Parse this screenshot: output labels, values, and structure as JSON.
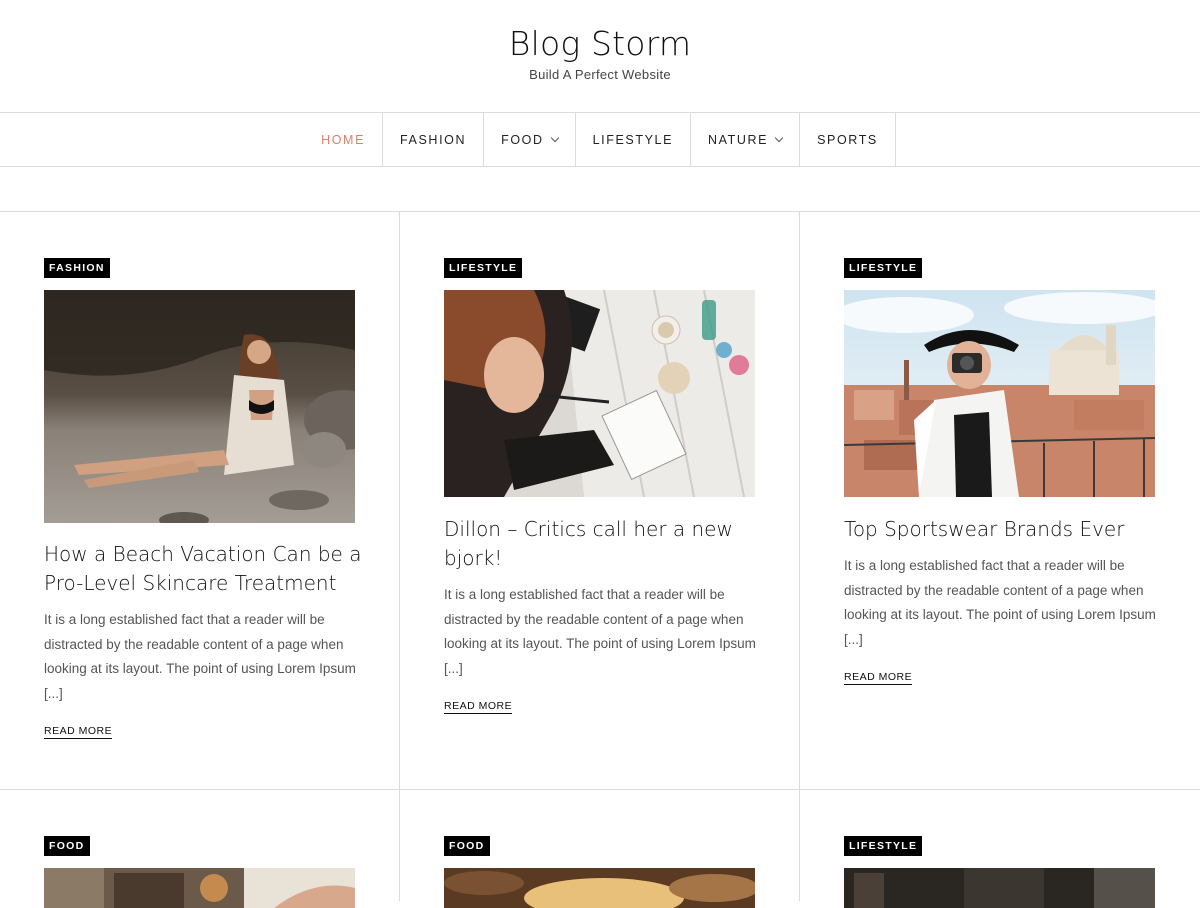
{
  "site": {
    "title": "Blog Storm",
    "tagline": "Build A Perfect Website"
  },
  "nav": {
    "items": [
      {
        "label": "HOME",
        "active": true,
        "dropdown": false
      },
      {
        "label": "FASHION",
        "active": false,
        "dropdown": false
      },
      {
        "label": "FOOD",
        "active": false,
        "dropdown": true
      },
      {
        "label": "LIFESTYLE",
        "active": false,
        "dropdown": false
      },
      {
        "label": "NATURE",
        "active": false,
        "dropdown": true
      },
      {
        "label": "SPORTS",
        "active": false,
        "dropdown": false
      }
    ],
    "active_color": "#d9806f"
  },
  "posts": [
    {
      "category": "FASHION",
      "title": "How a Beach Vacation Can be a Pro-Level Skincare Treatment",
      "excerpt": "It is a long established fact that a reader will be distracted by the readable content of a page when looking at its layout. The point of using Lorem Ipsum [...]",
      "read_more": "READ MORE",
      "image": "beach-cave-woman-photo"
    },
    {
      "category": "LIFESTYLE",
      "title": "Dillon – Critics call her a new bjork!",
      "excerpt": "It is a long established fact that a reader will be distracted by the readable content of a page when looking at its layout. The point of using Lorem Ipsum [...]",
      "read_more": "READ MORE",
      "image": "woman-writing-at-table-photo"
    },
    {
      "category": "LIFESTYLE",
      "title": "Top Sportswear Brands Ever",
      "excerpt": "It is a long established fact that a reader will be distracted by the readable content of a page when looking at its layout. The point of using Lorem Ipsum [...]",
      "read_more": "READ MORE",
      "image": "woman-camera-rooftops-photo"
    },
    {
      "category": "FOOD",
      "image": "food-table-photo"
    },
    {
      "category": "FOOD",
      "image": "food-plate-photo"
    },
    {
      "category": "LIFESTYLE",
      "image": "dark-lifestyle-photo"
    }
  ]
}
